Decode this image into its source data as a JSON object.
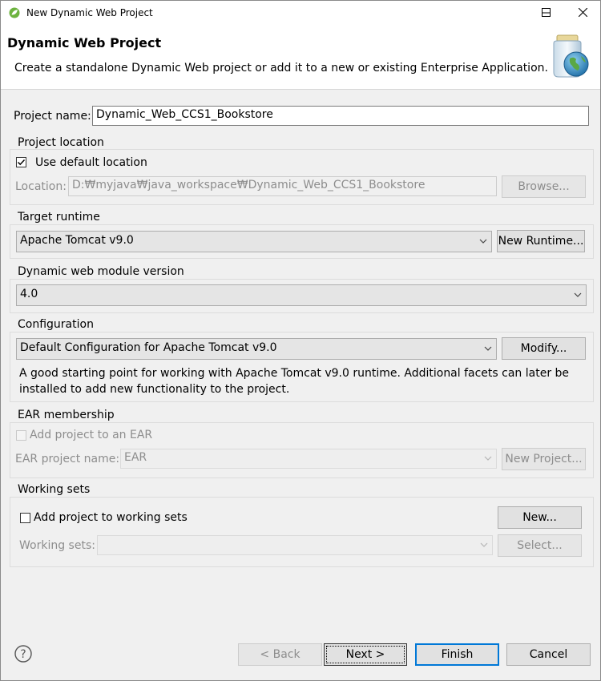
{
  "window": {
    "title": "New Dynamic Web Project",
    "controls": [
      "minimize-icon",
      "maximize-icon",
      "close-icon"
    ]
  },
  "header": {
    "title": "Dynamic Web Project",
    "description": "Create a standalone Dynamic Web project or add it to a new or existing Enterprise Application.",
    "icon": "globe-jar-icon"
  },
  "project_name": {
    "label": "Project name:",
    "value": "Dynamic_Web_CCS1_Bookstore"
  },
  "project_location": {
    "legend": "Project location",
    "use_default_label": "Use default location",
    "use_default_checked": true,
    "location_label": "Location:",
    "location_value": "D:₩myjava₩java_workspace₩Dynamic_Web_CCS1_Bookstore",
    "browse_label": "Browse..."
  },
  "target_runtime": {
    "legend": "Target runtime",
    "selected": "Apache Tomcat v9.0",
    "new_runtime_label": "New Runtime..."
  },
  "module_version": {
    "legend": "Dynamic web module version",
    "selected": "4.0"
  },
  "configuration": {
    "legend": "Configuration",
    "selected": "Default Configuration for Apache Tomcat v9.0",
    "modify_label": "Modify...",
    "description_line1": "A good starting point for working with Apache Tomcat v9.0 runtime. Additional facets can later be",
    "description_line2": "installed to add new functionality to the project."
  },
  "ear": {
    "legend": "EAR membership",
    "add_label": "Add project to an EAR",
    "add_checked": false,
    "name_label": "EAR project name:",
    "name_value": "EAR",
    "new_project_label": "New Project..."
  },
  "working_sets": {
    "legend": "Working sets",
    "add_label": "Add project to working sets",
    "add_checked": false,
    "new_label": "New...",
    "sets_label": "Working sets:",
    "sets_value": "",
    "select_label": "Select..."
  },
  "footer": {
    "help_icon": "help-icon",
    "back_label": "< Back",
    "next_label": "Next >",
    "finish_label": "Finish",
    "cancel_label": "Cancel"
  },
  "colors": {
    "accent": "#0078d7",
    "disabled_text": "#8d8d8d",
    "button_bg": "#e1e1e1",
    "header_bg": "#ffffff",
    "window_bg": "#f0f0f0"
  }
}
